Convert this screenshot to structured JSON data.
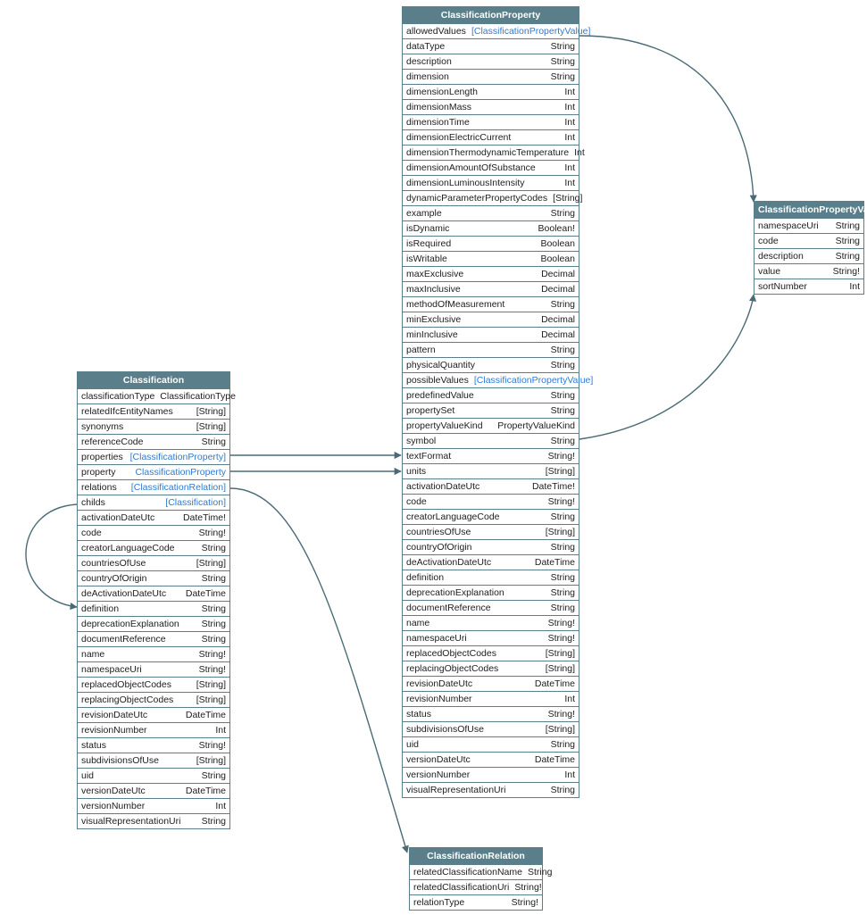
{
  "colors": {
    "header": "#5a7f8a",
    "link": "#2f7bd1",
    "stroke": "#4a6b76"
  },
  "entities": {
    "classification": {
      "title": "Classification",
      "fields": [
        {
          "name": "classificationType",
          "type": "ClassificationType",
          "link": false
        },
        {
          "name": "relatedIfcEntityNames",
          "type": "[String]",
          "link": false
        },
        {
          "name": "synonyms",
          "type": "[String]",
          "link": false
        },
        {
          "name": "referenceCode",
          "type": "String",
          "link": false
        },
        {
          "name": "properties",
          "type": "[ClassificationProperty]",
          "link": true
        },
        {
          "name": "property",
          "type": "ClassificationProperty",
          "link": true
        },
        {
          "name": "relations",
          "type": "[ClassificationRelation]",
          "link": true
        },
        {
          "name": "childs",
          "type": "[Classification]",
          "link": true
        },
        {
          "name": "activationDateUtc",
          "type": "DateTime!",
          "link": false
        },
        {
          "name": "code",
          "type": "String!",
          "link": false
        },
        {
          "name": "creatorLanguageCode",
          "type": "String",
          "link": false
        },
        {
          "name": "countriesOfUse",
          "type": "[String]",
          "link": false
        },
        {
          "name": "countryOfOrigin",
          "type": "String",
          "link": false
        },
        {
          "name": "deActivationDateUtc",
          "type": "DateTime",
          "link": false
        },
        {
          "name": "definition",
          "type": "String",
          "link": false
        },
        {
          "name": "deprecationExplanation",
          "type": "String",
          "link": false
        },
        {
          "name": "documentReference",
          "type": "String",
          "link": false
        },
        {
          "name": "name",
          "type": "String!",
          "link": false
        },
        {
          "name": "namespaceUri",
          "type": "String!",
          "link": false
        },
        {
          "name": "replacedObjectCodes",
          "type": "[String]",
          "link": false
        },
        {
          "name": "replacingObjectCodes",
          "type": "[String]",
          "link": false
        },
        {
          "name": "revisionDateUtc",
          "type": "DateTime",
          "link": false
        },
        {
          "name": "revisionNumber",
          "type": "Int",
          "link": false
        },
        {
          "name": "status",
          "type": "String!",
          "link": false
        },
        {
          "name": "subdivisionsOfUse",
          "type": "[String]",
          "link": false
        },
        {
          "name": "uid",
          "type": "String",
          "link": false
        },
        {
          "name": "versionDateUtc",
          "type": "DateTime",
          "link": false
        },
        {
          "name": "versionNumber",
          "type": "Int",
          "link": false
        },
        {
          "name": "visualRepresentationUri",
          "type": "String",
          "link": false
        }
      ]
    },
    "classificationProperty": {
      "title": "ClassificationProperty",
      "fields": [
        {
          "name": "allowedValues",
          "type": "[ClassificationPropertyValue]",
          "link": true
        },
        {
          "name": "dataType",
          "type": "String",
          "link": false
        },
        {
          "name": "description",
          "type": "String",
          "link": false
        },
        {
          "name": "dimension",
          "type": "String",
          "link": false
        },
        {
          "name": "dimensionLength",
          "type": "Int",
          "link": false
        },
        {
          "name": "dimensionMass",
          "type": "Int",
          "link": false
        },
        {
          "name": "dimensionTime",
          "type": "Int",
          "link": false
        },
        {
          "name": "dimensionElectricCurrent",
          "type": "Int",
          "link": false
        },
        {
          "name": "dimensionThermodynamicTemperature",
          "type": "Int",
          "link": false
        },
        {
          "name": "dimensionAmountOfSubstance",
          "type": "Int",
          "link": false
        },
        {
          "name": "dimensionLuminousIntensity",
          "type": "Int",
          "link": false
        },
        {
          "name": "dynamicParameterPropertyCodes",
          "type": "[String]",
          "link": false
        },
        {
          "name": "example",
          "type": "String",
          "link": false
        },
        {
          "name": "isDynamic",
          "type": "Boolean!",
          "link": false
        },
        {
          "name": "isRequired",
          "type": "Boolean",
          "link": false
        },
        {
          "name": "isWritable",
          "type": "Boolean",
          "link": false
        },
        {
          "name": "maxExclusive",
          "type": "Decimal",
          "link": false
        },
        {
          "name": "maxInclusive",
          "type": "Decimal",
          "link": false
        },
        {
          "name": "methodOfMeasurement",
          "type": "String",
          "link": false
        },
        {
          "name": "minExclusive",
          "type": "Decimal",
          "link": false
        },
        {
          "name": "minInclusive",
          "type": "Decimal",
          "link": false
        },
        {
          "name": "pattern",
          "type": "String",
          "link": false
        },
        {
          "name": "physicalQuantity",
          "type": "String",
          "link": false
        },
        {
          "name": "possibleValues",
          "type": "[ClassificationPropertyValue]",
          "link": true
        },
        {
          "name": "predefinedValue",
          "type": "String",
          "link": false
        },
        {
          "name": "propertySet",
          "type": "String",
          "link": false
        },
        {
          "name": "propertyValueKind",
          "type": "PropertyValueKind",
          "link": false
        },
        {
          "name": "symbol",
          "type": "String",
          "link": false
        },
        {
          "name": "textFormat",
          "type": "String!",
          "link": false
        },
        {
          "name": "units",
          "type": "[String]",
          "link": false
        },
        {
          "name": "activationDateUtc",
          "type": "DateTime!",
          "link": false
        },
        {
          "name": "code",
          "type": "String!",
          "link": false
        },
        {
          "name": "creatorLanguageCode",
          "type": "String",
          "link": false
        },
        {
          "name": "countriesOfUse",
          "type": "[String]",
          "link": false
        },
        {
          "name": "countryOfOrigin",
          "type": "String",
          "link": false
        },
        {
          "name": "deActivationDateUtc",
          "type": "DateTime",
          "link": false
        },
        {
          "name": "definition",
          "type": "String",
          "link": false
        },
        {
          "name": "deprecationExplanation",
          "type": "String",
          "link": false
        },
        {
          "name": "documentReference",
          "type": "String",
          "link": false
        },
        {
          "name": "name",
          "type": "String!",
          "link": false
        },
        {
          "name": "namespaceUri",
          "type": "String!",
          "link": false
        },
        {
          "name": "replacedObjectCodes",
          "type": "[String]",
          "link": false
        },
        {
          "name": "replacingObjectCodes",
          "type": "[String]",
          "link": false
        },
        {
          "name": "revisionDateUtc",
          "type": "DateTime",
          "link": false
        },
        {
          "name": "revisionNumber",
          "type": "Int",
          "link": false
        },
        {
          "name": "status",
          "type": "String!",
          "link": false
        },
        {
          "name": "subdivisionsOfUse",
          "type": "[String]",
          "link": false
        },
        {
          "name": "uid",
          "type": "String",
          "link": false
        },
        {
          "name": "versionDateUtc",
          "type": "DateTime",
          "link": false
        },
        {
          "name": "versionNumber",
          "type": "Int",
          "link": false
        },
        {
          "name": "visualRepresentationUri",
          "type": "String",
          "link": false
        }
      ]
    },
    "classificationPropertyValue": {
      "title": "ClassificationPropertyValue",
      "fields": [
        {
          "name": "namespaceUri",
          "type": "String",
          "link": false
        },
        {
          "name": "code",
          "type": "String",
          "link": false
        },
        {
          "name": "description",
          "type": "String",
          "link": false
        },
        {
          "name": "value",
          "type": "String!",
          "link": false
        },
        {
          "name": "sortNumber",
          "type": "Int",
          "link": false
        }
      ]
    },
    "classificationRelation": {
      "title": "ClassificationRelation",
      "fields": [
        {
          "name": "relatedClassificationName",
          "type": "String",
          "link": false
        },
        {
          "name": "relatedClassificationUri",
          "type": "String!",
          "link": false
        },
        {
          "name": "relationType",
          "type": "String!",
          "link": false
        }
      ]
    }
  }
}
